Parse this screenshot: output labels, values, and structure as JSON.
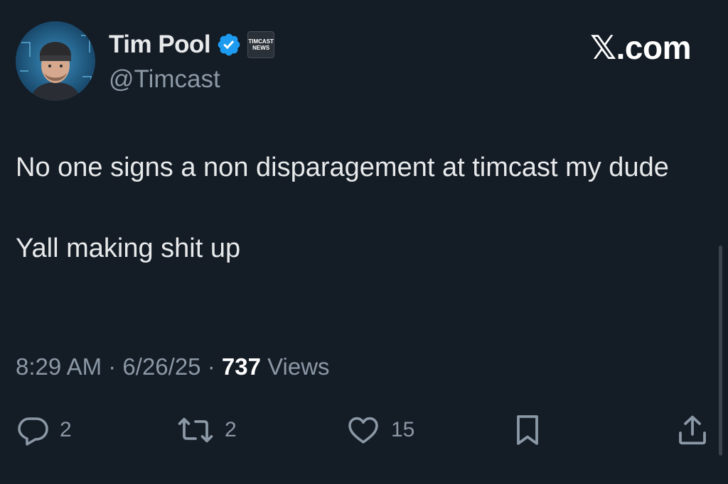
{
  "author": {
    "display_name": "Tim Pool",
    "handle": "@Timcast",
    "verified_icon": "verified-badge-icon",
    "affiliate_badge_text": "TIMCAST\nNEWS"
  },
  "brand": "𝕏.com",
  "tweet": {
    "line1": "No one signs a non disparagement at timcast my dude",
    "line2": "Yall making shit up"
  },
  "meta": {
    "time": "8:29 AM",
    "separator": "·",
    "date": "6/26/25",
    "views_count": "737",
    "views_label": "Views"
  },
  "actions": {
    "replies": "2",
    "reposts": "2",
    "likes": "15"
  },
  "colors": {
    "background": "#141c26",
    "text": "#e7e9ea",
    "secondary": "#8b98a5",
    "verified": "#1d9bf0"
  }
}
